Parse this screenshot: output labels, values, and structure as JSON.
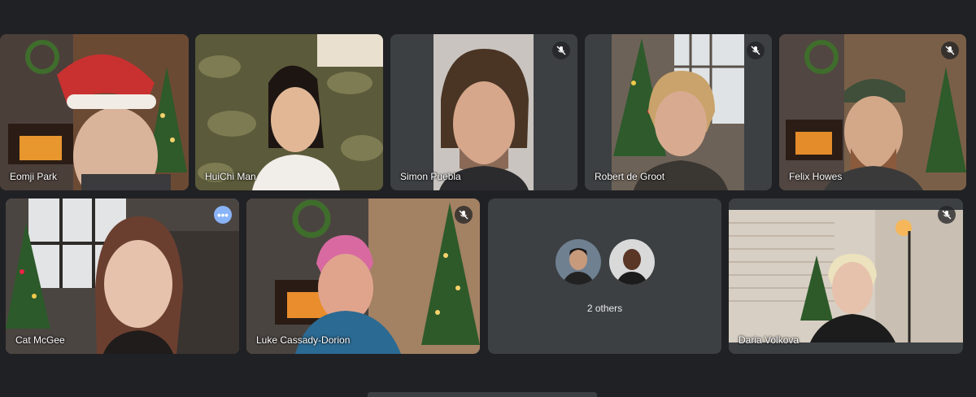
{
  "participants": [
    {
      "name": "Eomji Park"
    },
    {
      "name": "HuiChi Man"
    },
    {
      "name": "Simon Puebla",
      "muted": true
    },
    {
      "name": "Robert de Groot",
      "muted": true
    },
    {
      "name": "Felix Howes",
      "muted": true
    },
    {
      "name": "Cat McGee",
      "active": true
    },
    {
      "name": "Luke Cassady-Dorion",
      "muted": true
    },
    {
      "name": "Daria Volkova",
      "muted": true
    }
  ],
  "others": {
    "label": "2 others",
    "count": 2
  },
  "icons": {
    "mute": "mic-off-icon",
    "more": "more-options-icon"
  },
  "colors": {
    "background": "#202124",
    "tile": "#3c4043",
    "active_outline": "#8ab4f8"
  }
}
